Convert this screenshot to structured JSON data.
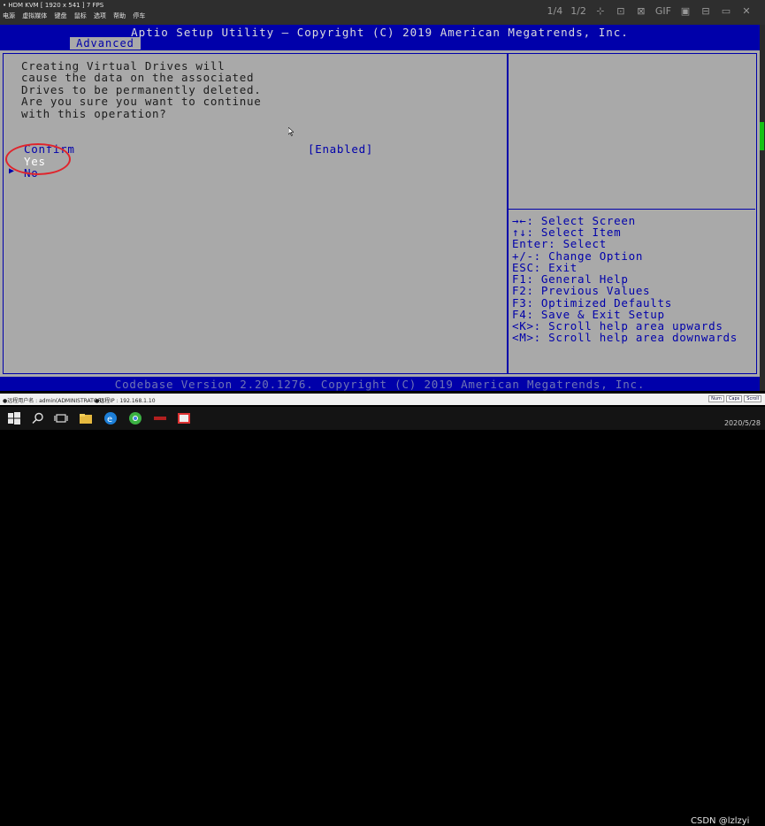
{
  "kvm": {
    "title": "• HDM KVM  [ 1920 x 541 ]  7 FPS",
    "menu": [
      "电源",
      "虚拟媒体",
      "键盘",
      "鼠标",
      "选项",
      "帮助",
      "停车"
    ],
    "toolbar": [
      "1/4",
      "1/2",
      "⊹",
      "⊡",
      "⊠",
      "GIF",
      "▣",
      "⊟",
      "▭",
      "✕"
    ]
  },
  "bios": {
    "title": "Aptio Setup Utility – Copyright (C) 2019 American Megatrends, Inc.",
    "tab_active": "Advanced",
    "warning_lines": [
      "Creating Virtual Drives will",
      "cause the data on the associated",
      "Drives to be permanently deleted.",
      "Are you sure you want to continue",
      "with this operation?"
    ],
    "options": {
      "confirm_label": "Confirm",
      "confirm_value": "[Enabled]",
      "yes": "Yes",
      "no": "No",
      "pointer": "▶"
    },
    "help_lines": [
      "→←: Select Screen",
      "↑↓: Select Item",
      "Enter: Select",
      "+/-: Change Option",
      "ESC: Exit",
      "F1: General Help",
      "F2: Previous Values",
      "F3: Optimized Defaults",
      "F4: Save & Exit Setup",
      "<K>: Scroll help area upwards",
      "<M>: Scroll help area downwards"
    ],
    "footer": "Codebase Version 2.20.1276. Copyright (C) 2019 American Megatrends, Inc."
  },
  "status": {
    "user": "●远程用户名 : admin(ADMINISTRATOR)",
    "ip": "●远程IP : 192.168.1.10",
    "indicators": [
      "Num",
      "Caps",
      "Scroll"
    ]
  },
  "taskbar": {
    "date": "2020/5/28",
    "watermark": "CSDN @lzlzyi"
  },
  "colors": {
    "bios_blue": "#0000aa",
    "bios_gray": "#a9a9a9",
    "highlight_ring": "#e0242c",
    "scroll_thumb": "#15c215"
  }
}
